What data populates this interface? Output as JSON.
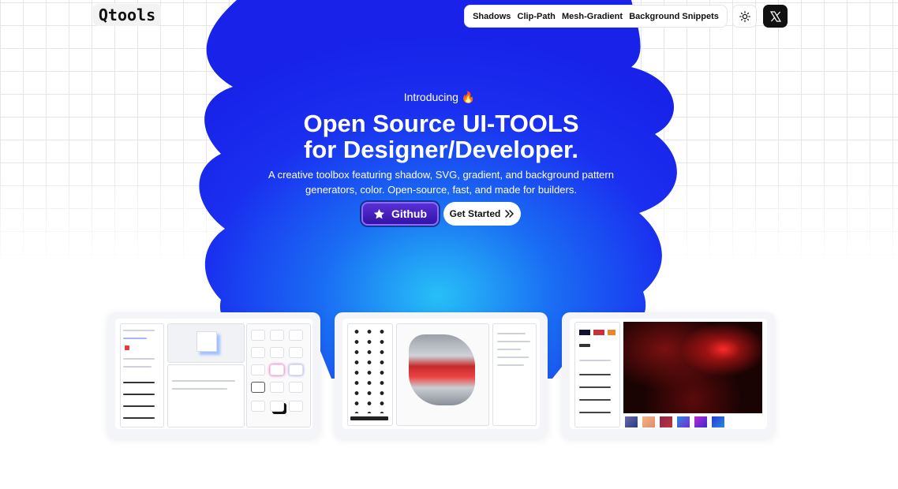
{
  "logo": {
    "text": "Qtools"
  },
  "nav": {
    "links": [
      "Shadows",
      "Clip-Path",
      "Mesh-Gradient",
      "Background Snippets"
    ],
    "theme_icon": "sun-icon",
    "social_icon": "x-logo-icon"
  },
  "hero": {
    "badge": "Introducing 🔥",
    "title_line1": "Open Source UI-TOOLS",
    "title_line2": "for Designer/Developer.",
    "subtitle_line1": "A creative toolbox featuring shadow, SVG, gradient, and background pattern",
    "subtitle_line2": "generators, color. Open-source, fast, and made for builders.",
    "github_label": "Github",
    "get_started_label": "Get Started"
  },
  "colors": {
    "blob": "#1a2ff0",
    "blob_glow": "#27c0f7",
    "nav_dark": "#111111"
  },
  "previews": [
    {
      "name": "shadow-generator-preview"
    },
    {
      "name": "clip-path-editor-preview"
    },
    {
      "name": "mesh-gradient-preview"
    }
  ]
}
